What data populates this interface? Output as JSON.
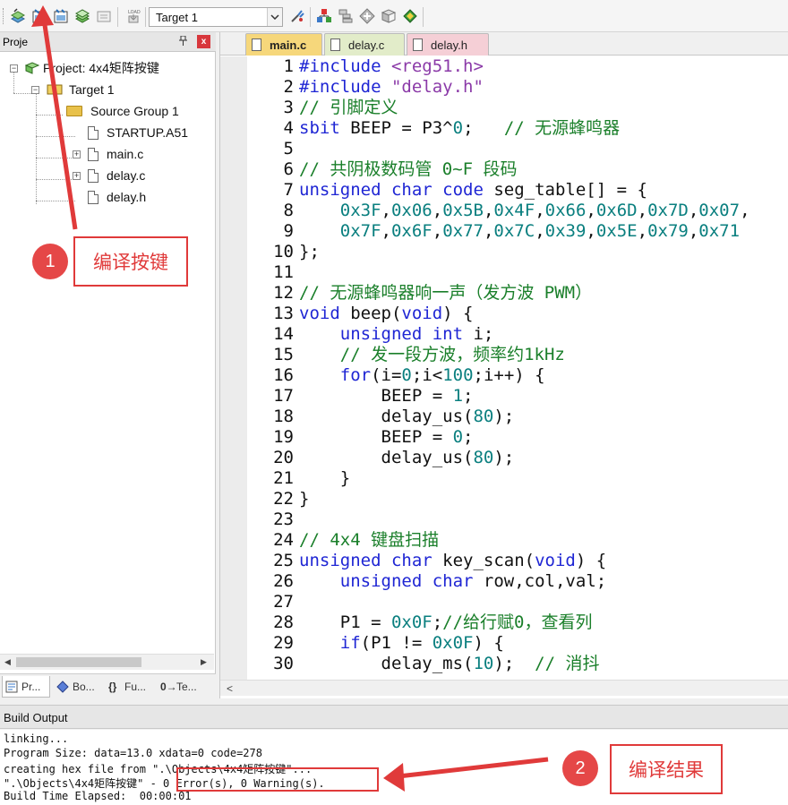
{
  "toolbar": {
    "target_select": "Target 1",
    "icons": [
      "translate-icon",
      "build-icon",
      "rebuild-icon",
      "batch-build-icon",
      "stop-build-icon",
      "download-icon",
      "target-options-icon",
      "manage-components-icon",
      "file-extensions-icon",
      "select-packs-icon",
      "pack-installer-icon",
      "device-icon"
    ]
  },
  "project_panel": {
    "title": "Proje",
    "pin": "ᵽ",
    "close": "x",
    "tree": {
      "project": "Project: 4x4矩阵按键",
      "target": "Target 1",
      "group": "Source Group 1",
      "files": [
        "STARTUP.A51",
        "main.c",
        "delay.c",
        "delay.h"
      ]
    },
    "bottom_tabs": [
      "Pr...",
      "Bo...",
      "Fu...",
      "Te..."
    ]
  },
  "editor": {
    "tabs": [
      {
        "label": "main.c",
        "active": true
      },
      {
        "label": "delay.c",
        "active": false
      },
      {
        "label": "delay.h",
        "active": false
      }
    ],
    "lines": [
      {
        "n": "1",
        "segs": [
          [
            "k",
            "#include "
          ],
          [
            "s",
            "<reg51.h>"
          ]
        ]
      },
      {
        "n": "2",
        "segs": [
          [
            "k",
            "#include "
          ],
          [
            "s",
            "\"delay.h\""
          ]
        ]
      },
      {
        "n": "3",
        "segs": [
          [
            "c",
            "// 引脚定义"
          ]
        ]
      },
      {
        "n": "4",
        "segs": [
          [
            "k",
            "sbit"
          ],
          [
            "t",
            " BEEP = P3^"
          ],
          [
            "n",
            "0"
          ],
          [
            "t",
            ";   "
          ],
          [
            "c",
            "// 无源蜂鸣器"
          ]
        ]
      },
      {
        "n": "5",
        "segs": []
      },
      {
        "n": "6",
        "segs": [
          [
            "c",
            "// 共阴极数码管 0~F 段码"
          ]
        ]
      },
      {
        "n": "7",
        "segs": [
          [
            "k",
            "unsigned char code"
          ],
          [
            "t",
            " seg_table[] = {"
          ]
        ]
      },
      {
        "n": "8",
        "segs": [
          [
            "t",
            "    "
          ],
          [
            "n",
            "0x3F"
          ],
          [
            "t",
            ","
          ],
          [
            "n",
            "0x06"
          ],
          [
            "t",
            ","
          ],
          [
            "n",
            "0x5B"
          ],
          [
            "t",
            ","
          ],
          [
            "n",
            "0x4F"
          ],
          [
            "t",
            ","
          ],
          [
            "n",
            "0x66"
          ],
          [
            "t",
            ","
          ],
          [
            "n",
            "0x6D"
          ],
          [
            "t",
            ","
          ],
          [
            "n",
            "0x7D"
          ],
          [
            "t",
            ","
          ],
          [
            "n",
            "0x07"
          ],
          [
            "t",
            ","
          ]
        ]
      },
      {
        "n": "9",
        "segs": [
          [
            "t",
            "    "
          ],
          [
            "n",
            "0x7F"
          ],
          [
            "t",
            ","
          ],
          [
            "n",
            "0x6F"
          ],
          [
            "t",
            ","
          ],
          [
            "n",
            "0x77"
          ],
          [
            "t",
            ","
          ],
          [
            "n",
            "0x7C"
          ],
          [
            "t",
            ","
          ],
          [
            "n",
            "0x39"
          ],
          [
            "t",
            ","
          ],
          [
            "n",
            "0x5E"
          ],
          [
            "t",
            ","
          ],
          [
            "n",
            "0x79"
          ],
          [
            "t",
            ","
          ],
          [
            "n",
            "0x71"
          ]
        ]
      },
      {
        "n": "10",
        "segs": [
          [
            "t",
            "};"
          ]
        ]
      },
      {
        "n": "11",
        "segs": []
      },
      {
        "n": "12",
        "segs": [
          [
            "c",
            "// 无源蜂鸣器响一声（发方波 PWM）"
          ]
        ]
      },
      {
        "n": "13",
        "segs": [
          [
            "k",
            "void"
          ],
          [
            "t",
            " beep("
          ],
          [
            "k",
            "void"
          ],
          [
            "t",
            ") {"
          ]
        ]
      },
      {
        "n": "14",
        "segs": [
          [
            "t",
            "    "
          ],
          [
            "k",
            "unsigned int"
          ],
          [
            "t",
            " i;"
          ]
        ]
      },
      {
        "n": "15",
        "segs": [
          [
            "t",
            "    "
          ],
          [
            "c",
            "// 发一段方波，频率约1kHz"
          ]
        ]
      },
      {
        "n": "16",
        "segs": [
          [
            "t",
            "    "
          ],
          [
            "k",
            "for"
          ],
          [
            "t",
            "(i="
          ],
          [
            "n",
            "0"
          ],
          [
            "t",
            ";i<"
          ],
          [
            "n",
            "100"
          ],
          [
            "t",
            ";i++) {"
          ]
        ]
      },
      {
        "n": "17",
        "segs": [
          [
            "t",
            "        BEEP = "
          ],
          [
            "n",
            "1"
          ],
          [
            "t",
            ";"
          ]
        ]
      },
      {
        "n": "18",
        "segs": [
          [
            "t",
            "        delay_us("
          ],
          [
            "n",
            "80"
          ],
          [
            "t",
            ");"
          ]
        ]
      },
      {
        "n": "19",
        "segs": [
          [
            "t",
            "        BEEP = "
          ],
          [
            "n",
            "0"
          ],
          [
            "t",
            ";"
          ]
        ]
      },
      {
        "n": "20",
        "segs": [
          [
            "t",
            "        delay_us("
          ],
          [
            "n",
            "80"
          ],
          [
            "t",
            ");"
          ]
        ]
      },
      {
        "n": "21",
        "segs": [
          [
            "t",
            "    }"
          ]
        ]
      },
      {
        "n": "22",
        "segs": [
          [
            "t",
            "}"
          ]
        ]
      },
      {
        "n": "23",
        "segs": []
      },
      {
        "n": "24",
        "segs": [
          [
            "c",
            "// 4x4 键盘扫描"
          ]
        ]
      },
      {
        "n": "25",
        "segs": [
          [
            "k",
            "unsigned char"
          ],
          [
            "t",
            " key_scan("
          ],
          [
            "k",
            "void"
          ],
          [
            "t",
            ") {"
          ]
        ]
      },
      {
        "n": "26",
        "segs": [
          [
            "t",
            "    "
          ],
          [
            "k",
            "unsigned char"
          ],
          [
            "t",
            " row,col,val;"
          ]
        ]
      },
      {
        "n": "27",
        "segs": []
      },
      {
        "n": "28",
        "segs": [
          [
            "t",
            "    P1 = "
          ],
          [
            "n",
            "0x0F"
          ],
          [
            "t",
            ";"
          ],
          [
            "c",
            "//给行赋0，查看列"
          ]
        ]
      },
      {
        "n": "29",
        "segs": [
          [
            "t",
            "    "
          ],
          [
            "k",
            "if"
          ],
          [
            "t",
            "(P1 != "
          ],
          [
            "n",
            "0x0F"
          ],
          [
            "t",
            ") {"
          ]
        ]
      },
      {
        "n": "30",
        "segs": [
          [
            "t",
            "        delay_ms("
          ],
          [
            "n",
            "10"
          ],
          [
            "t",
            ");  "
          ],
          [
            "c",
            "// 消抖"
          ]
        ]
      }
    ]
  },
  "build_output": {
    "title": "Build Output",
    "lines": [
      "linking...",
      "Program Size: data=13.0 xdata=0 code=278",
      "creating hex file from \".\\Objects\\4x4矩阵按键\"...",
      "\".\\Objects\\4x4矩阵按键\" - 0 Error(s), 0 Warning(s).",
      "Build Time Elapsed:  00:00:01"
    ]
  },
  "annotations": {
    "marker1": "1",
    "label1": "编译按键",
    "marker2": "2",
    "label2": "编译结果",
    "color": "#e03a3a"
  }
}
